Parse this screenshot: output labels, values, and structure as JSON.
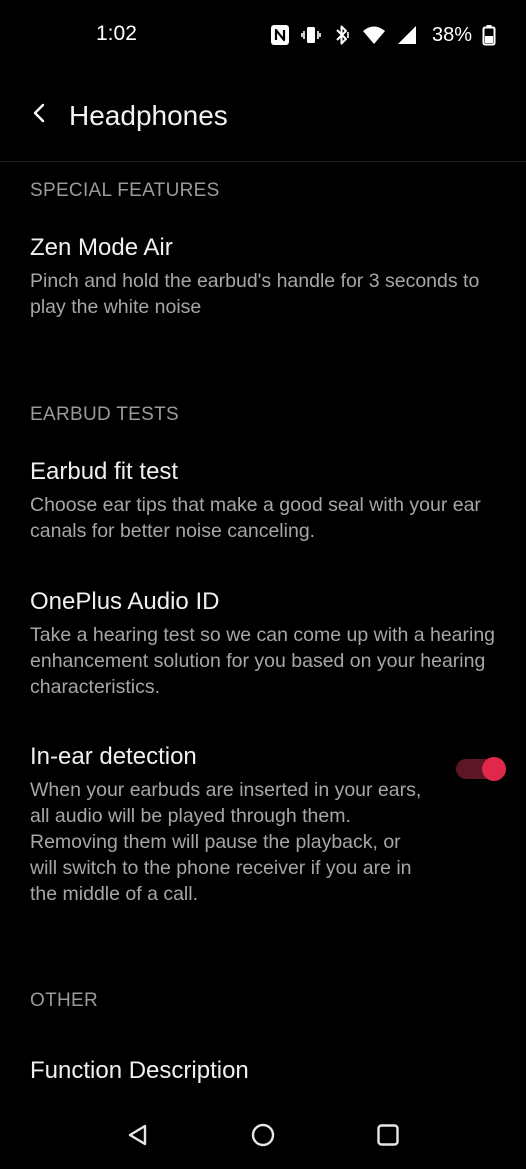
{
  "status_bar": {
    "time": "1:02",
    "battery": "38%",
    "icons": [
      "nfc-icon",
      "vibrate-icon",
      "bluetooth-icon",
      "wifi-icon",
      "signal-icon",
      "battery-icon"
    ]
  },
  "header": {
    "title": "Headphones",
    "back_icon": "back-arrow-icon"
  },
  "sections": {
    "special_features": {
      "label": "SPECIAL FEATURES",
      "zen_mode": {
        "title": "Zen Mode Air",
        "description": "Pinch and hold the earbud's handle for 3 seconds to play the white noise"
      }
    },
    "earbud_tests": {
      "label": "EARBUD TESTS",
      "fit_test": {
        "title": "Earbud fit test",
        "description": "Choose ear tips that make a good seal with your ear canals for better noise canceling."
      },
      "audio_id": {
        "title": "OnePlus Audio ID",
        "description": "Take a hearing test so we can come up with a hearing enhancement solution for you based on your hearing characteristics."
      },
      "in_ear_detection": {
        "title": "In-ear detection",
        "description": "When your earbuds are inserted in your ears, all audio will be played through them. Removing them will pause the playback, or will switch to the phone receiver if you are in the middle of a call.",
        "enabled": true
      }
    },
    "other": {
      "label": "OTHER",
      "function_description": {
        "title": "Function Description"
      }
    }
  },
  "nav_bar": {
    "buttons": [
      "back-triangle-icon",
      "home-circle-icon",
      "recents-square-icon"
    ]
  },
  "colors": {
    "background": "#000000",
    "accent": "#e0284a",
    "toggle_track": "#5c1626",
    "section_header": "#9a9a9a",
    "secondary_text": "#a6a6a6"
  }
}
